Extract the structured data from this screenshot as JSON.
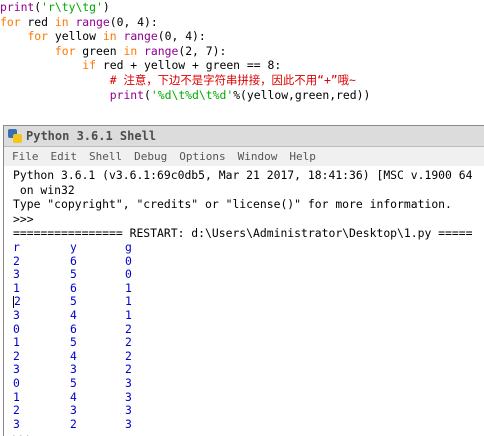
{
  "editor": {
    "line1": {
      "a": "print",
      "b": "(",
      "c": "'r\\ty\\tg'",
      "d": ")"
    },
    "line2": {
      "kw1": "for",
      "t1": " red ",
      "kw2": "in",
      "t2": " ",
      "bi": "range",
      "t3": "(0, 4):"
    },
    "line3": {
      "indent": "    ",
      "kw1": "for",
      "t1": " yellow ",
      "kw2": "in",
      "t2": " ",
      "bi": "range",
      "t3": "(0, 4):"
    },
    "line4": {
      "indent": "        ",
      "kw1": "for",
      "t1": " green ",
      "kw2": "in",
      "t2": " ",
      "bi": "range",
      "t3": "(2, 7):"
    },
    "line5": {
      "indent": "            ",
      "kw1": "if",
      "t1": " red + yellow + green == 8:"
    },
    "line6": {
      "indent": "                ",
      "comment": "# 注意，下边不是字符串拼接，因此不用“+”哦~"
    },
    "line7": {
      "indent": "                ",
      "bi": "print",
      "t1": "(",
      "str": "'%d\\t%d\\t%d'",
      "t2": "%(yellow,green,red))"
    }
  },
  "shell": {
    "title": "Python 3.6.1 Shell",
    "menu": [
      "File",
      "Edit",
      "Shell",
      "Debug",
      "Options",
      "Window",
      "Help"
    ],
    "banner1": "Python 3.6.1 (v3.6.1:69c0db5, Mar 21 2017, 18:41:36) [MSC v.1900 64",
    "banner2": " on win32",
    "banner3": "Type \"copyright\", \"credits\" or \"license()\" for more information.",
    "prompt": ">>> ",
    "restart": "================ RESTART: d:\\Users\\Administrator\\Desktop\\1.py =====",
    "header": [
      "r",
      "y",
      "g"
    ],
    "rows": [
      [
        "2",
        "6",
        "0"
      ],
      [
        "3",
        "5",
        "0"
      ],
      [
        "1",
        "6",
        "1"
      ],
      [
        "2",
        "5",
        "1"
      ],
      [
        "3",
        "4",
        "1"
      ],
      [
        "0",
        "6",
        "2"
      ],
      [
        "1",
        "5",
        "2"
      ],
      [
        "2",
        "4",
        "2"
      ],
      [
        "3",
        "3",
        "2"
      ],
      [
        "0",
        "5",
        "3"
      ],
      [
        "1",
        "4",
        "3"
      ],
      [
        "2",
        "3",
        "3"
      ],
      [
        "3",
        "2",
        "3"
      ]
    ],
    "final_prompt": ">>>"
  }
}
